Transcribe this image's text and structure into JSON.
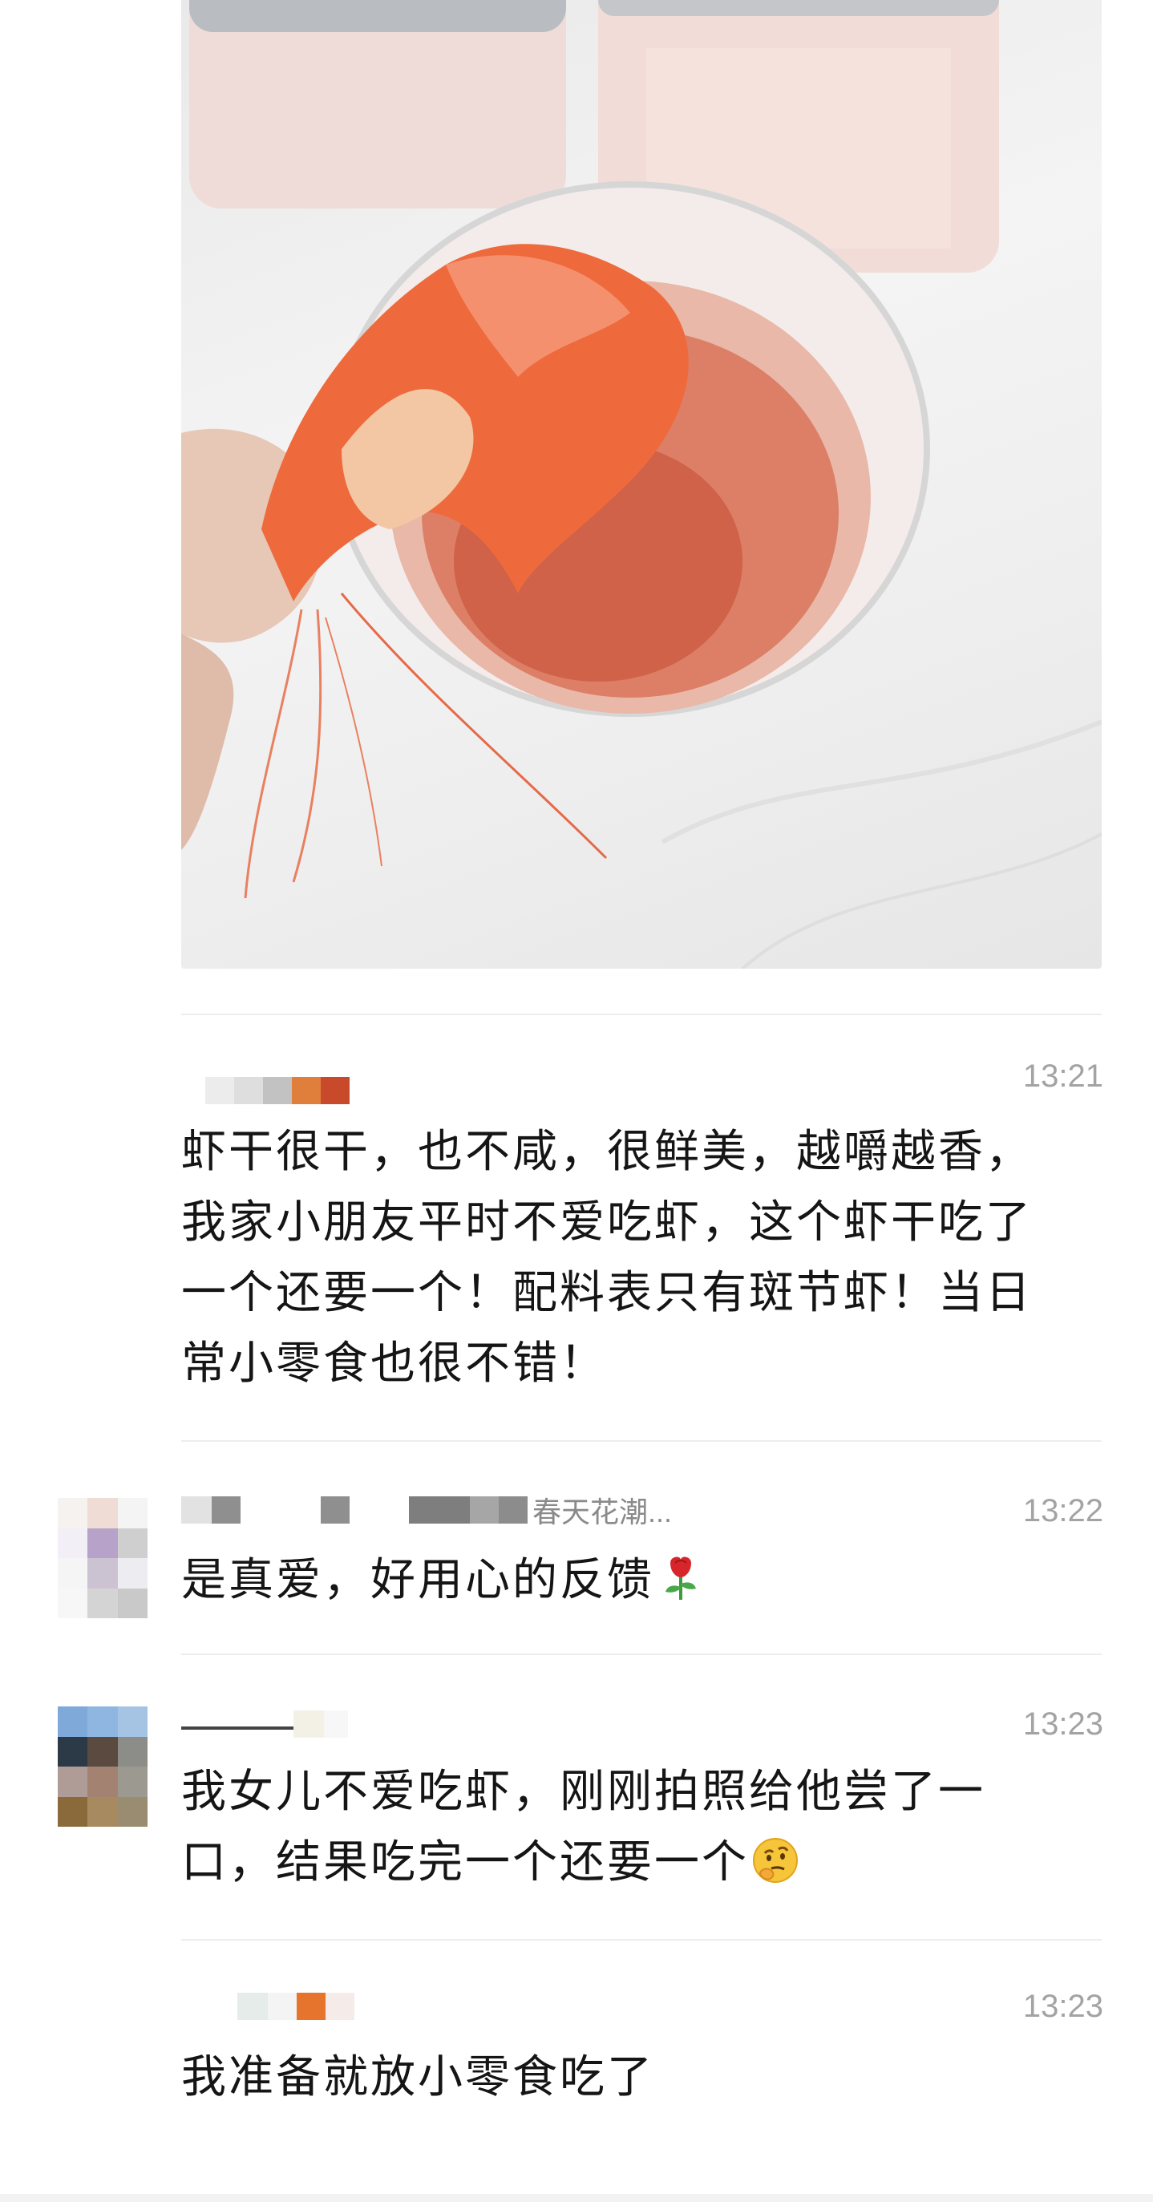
{
  "photo": {
    "description_icon": "dried-shrimp-photo-icon"
  },
  "comments": [
    {
      "time": "13:21",
      "text": "虾干很干，也不咸，很鲜美，越嚼越香，我家小朋友平时不爱吃虾，这个虾干吃了一个还要一个！配料表只有斑节虾！当日常小零食也很不错！",
      "nickname_visible": ""
    },
    {
      "time": "13:22",
      "nickname_visible": "春天花潮...",
      "text": "是真爱，好用心的反馈",
      "emoji": "rose-emoji-icon"
    },
    {
      "time": "13:23",
      "nickname_visible": "",
      "text": "我女儿不爱吃虾，刚刚拍照给他尝了一口，结果吃完一个还要一个",
      "emoji": "thinking-face-emoji-icon"
    },
    {
      "time": "13:23",
      "nickname_visible": "",
      "text": "我准备就放小零食吃了"
    }
  ],
  "colors": {
    "time": "#a3a3a3",
    "body_text": "#151515",
    "divider": "#ededed",
    "shrimp": "#e8643a"
  }
}
